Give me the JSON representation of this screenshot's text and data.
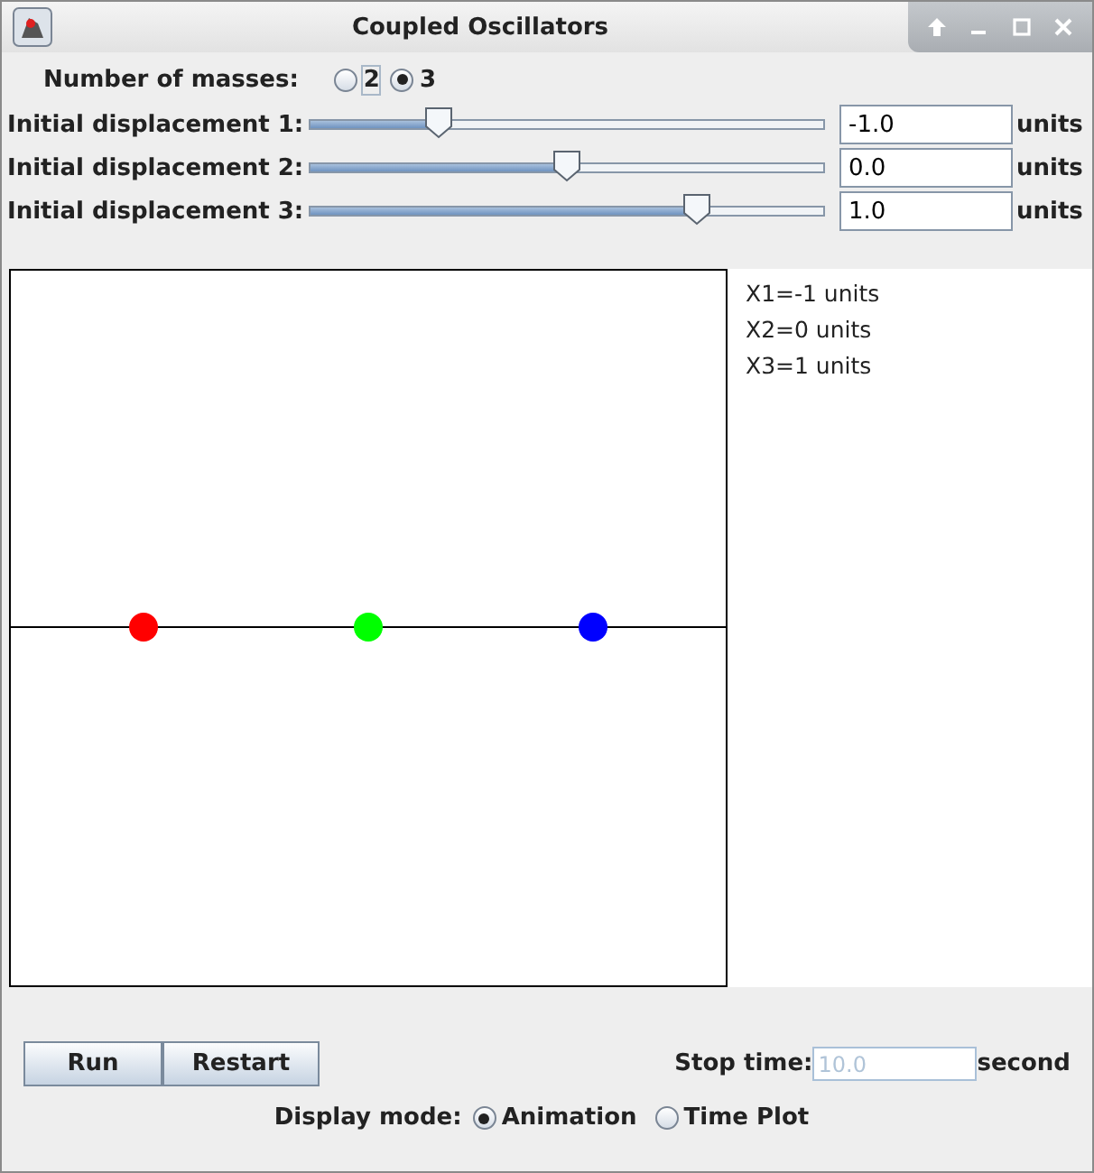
{
  "window": {
    "title": "Coupled Oscillators"
  },
  "masses_count": {
    "label": "Number of masses:",
    "options": [
      {
        "label": "2",
        "selected": false
      },
      {
        "label": "3",
        "selected": true
      }
    ]
  },
  "displacements": [
    {
      "label": "Initial displacement 1:",
      "level": 0.25,
      "value": "-1.0",
      "unit": "units"
    },
    {
      "label": "Initial displacement 2:",
      "level": 0.5,
      "value": "0.0",
      "unit": "units"
    },
    {
      "label": "Initial displacement 3:",
      "level": 0.75,
      "value": "1.0",
      "unit": "units"
    }
  ],
  "masses": [
    {
      "color": "#ff0000"
    },
    {
      "color": "#00ff00"
    },
    {
      "color": "#0000ff"
    }
  ],
  "readouts": [
    "X1=-1 units",
    "X2=0 units",
    "X3=1 units"
  ],
  "buttons": [
    "Run",
    "Restart"
  ],
  "stop_time": {
    "label": "Stop time:",
    "placeholder": "10.0",
    "unit": "second"
  },
  "display_mode": {
    "label": "Display mode:",
    "options": [
      {
        "label": "Animation",
        "selected": true
      },
      {
        "label": "Time Plot",
        "selected": false
      }
    ]
  }
}
